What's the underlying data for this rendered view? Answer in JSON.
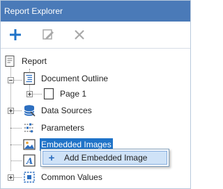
{
  "window": {
    "title": "Report Explorer"
  },
  "toolbar": {
    "add_icon": "plus-icon",
    "edit_icon": "pencil-icon",
    "delete_icon": "x-icon",
    "accent": "#1f73c8"
  },
  "tree": {
    "root": {
      "label": "Report",
      "icon": "report-icon"
    },
    "items": [
      {
        "label": "Document Outline",
        "icon": "document-outline-icon",
        "expanded": true
      },
      {
        "label": "Page 1",
        "icon": "page-icon",
        "expanded": false
      },
      {
        "label": "Data Sources",
        "icon": "database-icon",
        "expanded": false
      },
      {
        "label": "Parameters",
        "icon": "parameters-icon"
      },
      {
        "label": "Embedded Images",
        "icon": "image-icon",
        "selected": true
      },
      {
        "label": "",
        "icon": "font-icon"
      },
      {
        "label": "Common Values",
        "icon": "common-values-icon",
        "expanded": false
      }
    ]
  },
  "context_menu": {
    "items": [
      {
        "label": "Add Embedded Image",
        "icon": "plus-icon"
      }
    ]
  },
  "colors": {
    "titlebar": "#4a7ab8",
    "selection": "#1f73c8",
    "menu_highlight": "#cfe2f7"
  }
}
